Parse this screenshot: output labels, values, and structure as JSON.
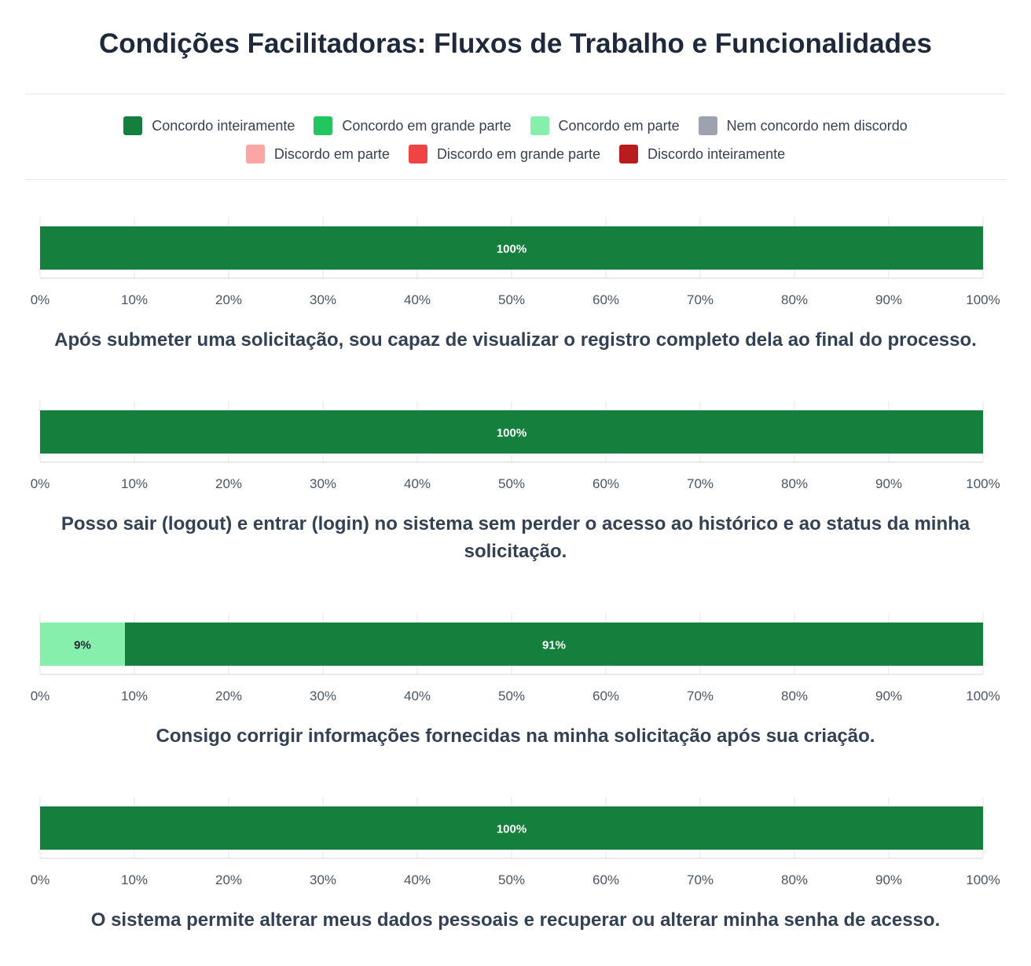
{
  "title": "Condições Facilitadoras: Fluxos de Trabalho e Funcionalidades",
  "legend": [
    {
      "label": "Concordo inteiramente",
      "color": "#15803d"
    },
    {
      "label": "Concordo em grande parte",
      "color": "#22c55e"
    },
    {
      "label": "Concordo em parte",
      "color": "#86efac"
    },
    {
      "label": "Nem concordo nem discordo",
      "color": "#9ca3af"
    },
    {
      "label": "Discordo em parte",
      "color": "#fca5a5"
    },
    {
      "label": "Discordo em grande parte",
      "color": "#ef4444"
    },
    {
      "label": "Discordo inteiramente",
      "color": "#b91c1c"
    }
  ],
  "chart_data": {
    "type": "bar",
    "orientation": "horizontal-stacked",
    "xlim": [
      0,
      100
    ],
    "ticks": [
      "0%",
      "10%",
      "20%",
      "30%",
      "40%",
      "50%",
      "60%",
      "70%",
      "80%",
      "90%",
      "100%"
    ],
    "grid": true,
    "legend_position": "top-center",
    "questions": [
      {
        "label": "Após submeter uma solicitação, sou capaz de visualizar o registro completo dela ao final do processo.",
        "segments": [
          {
            "series": "Concordo inteiramente",
            "value": 100,
            "text": "100%"
          }
        ]
      },
      {
        "label": "Posso sair (logout) e entrar (login) no sistema sem perder o acesso ao histórico e ao status da minha solicitação.",
        "segments": [
          {
            "series": "Concordo inteiramente",
            "value": 100,
            "text": "100%"
          }
        ]
      },
      {
        "label": "Consigo corrigir informações fornecidas na minha solicitação após sua criação.",
        "segments": [
          {
            "series": "Concordo em parte",
            "value": 9,
            "text": "9%"
          },
          {
            "series": "Concordo inteiramente",
            "value": 91,
            "text": "91%"
          }
        ]
      },
      {
        "label": "O sistema permite alterar meus dados pessoais e recuperar ou alterar minha senha de acesso.",
        "segments": [
          {
            "series": "Concordo inteiramente",
            "value": 100,
            "text": "100%"
          }
        ]
      }
    ]
  }
}
